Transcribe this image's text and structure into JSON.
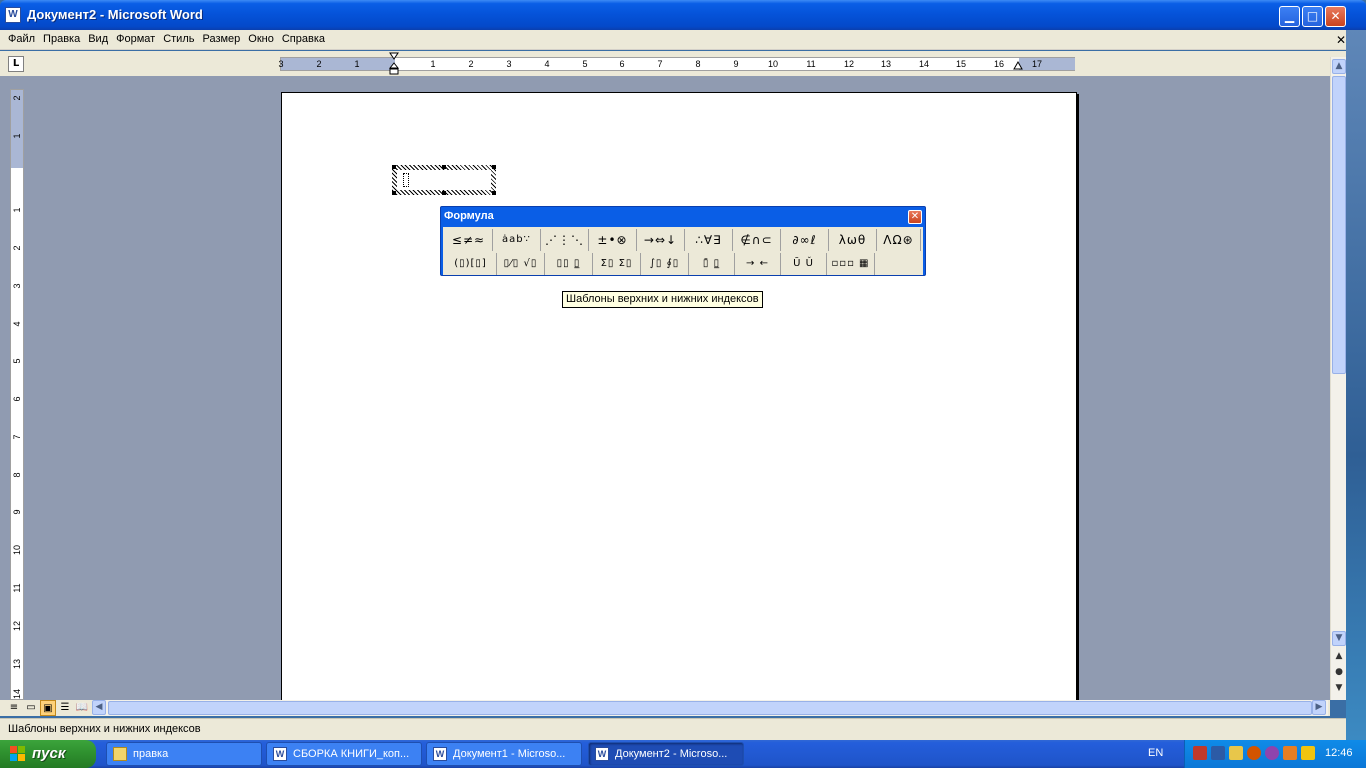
{
  "window": {
    "title": "Документ2 - Microsoft Word",
    "app_icon_glyph": "W",
    "min_glyph": "▁",
    "max_glyph": "□",
    "close_glyph": "✕"
  },
  "menu": {
    "items": [
      "Файл",
      "Правка",
      "Вид",
      "Формат",
      "Стиль",
      "Размер",
      "Окно",
      "Справка"
    ],
    "close_glyph": "✕"
  },
  "ruler": {
    "tab_glyph": "L",
    "h_numbers": [
      "3",
      "2",
      "1",
      "1",
      "2",
      "3",
      "4",
      "5",
      "6",
      "7",
      "8",
      "9",
      "10",
      "11",
      "12",
      "13",
      "14",
      "15",
      "16",
      "17"
    ],
    "v_numbers": [
      "2",
      "1",
      "1",
      "2",
      "3",
      "4",
      "5",
      "6",
      "7",
      "8",
      "9",
      "10",
      "11",
      "12",
      "13",
      "14"
    ]
  },
  "formula_palette": {
    "title": "Формула",
    "close_glyph": "✕",
    "row1": [
      "≤≠≈",
      "ȧab∵",
      "⋰⋮⋱",
      "±•⊗",
      "→⇔↓",
      "∴∀∃",
      "∉∩⊂",
      "∂∞ℓ",
      "λωθ",
      "ΛΩ⊛"
    ],
    "row2": [
      "(▯)[▯]",
      "▯⁄▯ √▯",
      "▯▯ ▯̲",
      "Σ▯ Σ▯",
      "∫▯ ∮▯",
      "▯̄ ▯̲",
      "→ ←",
      "Ū Ǔ",
      "▫▫▫ ▦"
    ]
  },
  "tooltip": "Шаблоны верхних и нижних индексов",
  "status": {
    "text": "Шаблоны верхних и нижних индексов"
  },
  "scrollbar": {
    "up_glyph": "▲",
    "down_glyph": "▼",
    "left_glyph": "◀",
    "right_glyph": "▶",
    "prev_page_glyph": "▲",
    "browse_glyph": "●",
    "next_page_glyph": "▼"
  },
  "view_buttons": [
    "≡",
    "▭",
    "▣",
    "☰",
    "📖"
  ],
  "taskbar": {
    "start_label": "пуск",
    "tasks": [
      {
        "label": "правка",
        "icon": "folder"
      },
      {
        "label": "СБОРКА КНИГИ_коп...",
        "icon": "word"
      },
      {
        "label": "Документ1 - Microso...",
        "icon": "word"
      },
      {
        "label": "Документ2 - Microso...",
        "icon": "word",
        "active": true
      }
    ],
    "language": "EN",
    "clock": "12:46"
  },
  "colors": {
    "titlebar": "#0552d8",
    "workspace": "#909bb1",
    "chrome": "#ece9d8",
    "tooltip_bg": "#ffffe1"
  }
}
